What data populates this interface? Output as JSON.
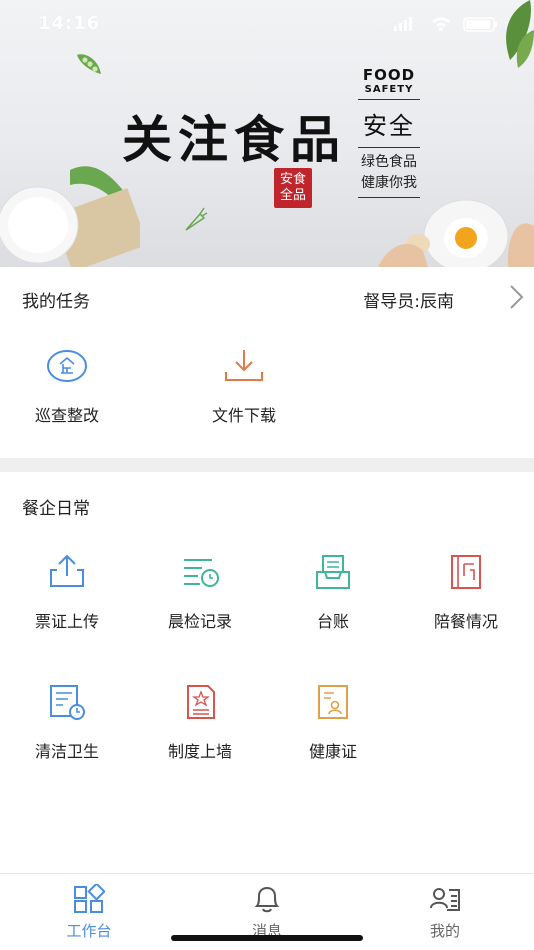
{
  "status_bar": {
    "time": "14:16"
  },
  "banner": {
    "headline": "关注食品",
    "seal_line1": "安食",
    "seal_line2": "全品",
    "food_title": "FOOD",
    "food_sub": "SAFETY",
    "anquan": "安全",
    "tagline1": "绿色食品",
    "tagline2": "健康你我"
  },
  "tasks": {
    "title": "我的任务",
    "supervisor": "督导员:辰南",
    "items": [
      {
        "label": "巡查整改",
        "icon": "enterprise-icon"
      },
      {
        "label": "文件下载",
        "icon": "download-icon"
      }
    ]
  },
  "daily": {
    "title": "餐企日常",
    "items": [
      {
        "label": "票证上传",
        "icon": "upload-icon"
      },
      {
        "label": "晨检记录",
        "icon": "checklist-clock-icon"
      },
      {
        "label": "台账",
        "icon": "ledger-tray-icon"
      },
      {
        "label": "陪餐情况",
        "icon": "book-icon"
      },
      {
        "label": "清洁卫生",
        "icon": "document-clock-icon"
      },
      {
        "label": "制度上墙",
        "icon": "document-star-icon"
      },
      {
        "label": "健康证",
        "icon": "health-certificate-icon"
      }
    ]
  },
  "tabbar": {
    "tabs": [
      {
        "label": "工作台",
        "icon": "workbench-icon",
        "active": true
      },
      {
        "label": "消息",
        "icon": "bell-icon",
        "active": false
      },
      {
        "label": "我的",
        "icon": "profile-card-icon",
        "active": false
      }
    ]
  },
  "colors": {
    "accent": "#4a8de0",
    "orange": "#e07b4a",
    "teal": "#3fb59a",
    "red": "#d9534f",
    "divider": "#efefef"
  }
}
